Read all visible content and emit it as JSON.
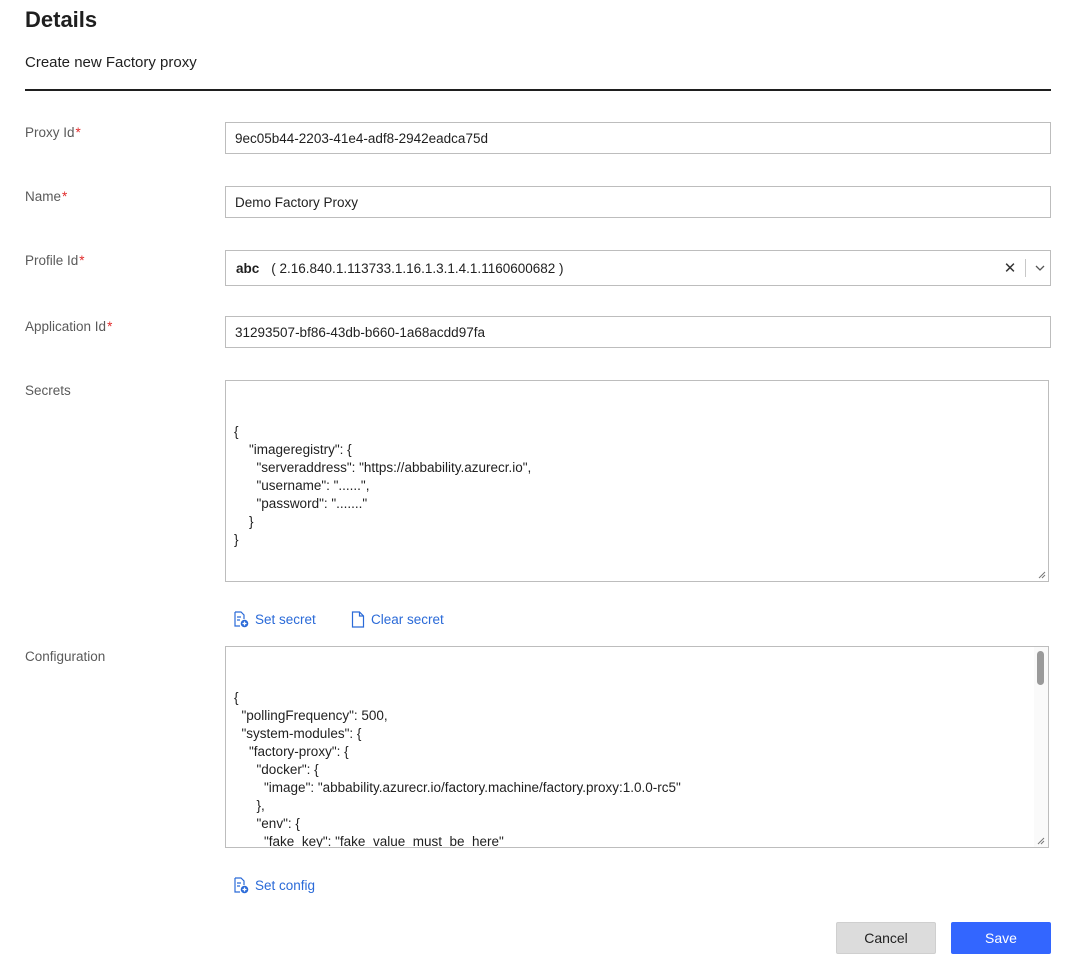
{
  "header": {
    "title": "Details",
    "subtitle": "Create new Factory proxy"
  },
  "fields": {
    "proxy_id": {
      "label": "Proxy Id",
      "required_mark": "*",
      "value": "9ec05b44-2203-41e4-adf8-2942eadca75d"
    },
    "name": {
      "label": "Name",
      "required_mark": "*",
      "value": "Demo Factory Proxy"
    },
    "profile_id": {
      "label": "Profile Id",
      "required_mark": "*",
      "selected_name": "abc",
      "selected_detail": "( 2.16.840.1.113733.1.16.1.3.1.4.1.1160600682 )"
    },
    "application_id": {
      "label": "Application Id",
      "required_mark": "*",
      "value": "31293507-bf86-43db-b660-1a68acdd97fa"
    },
    "secrets": {
      "label": "Secrets",
      "value": "{\n    \"imageregistry\": {\n      \"serveraddress\": \"https://abbability.azurecr.io\",\n      \"username\": \"......\",\n      \"password\": \".......\"\n    }\n}"
    },
    "configuration": {
      "label": "Configuration",
      "value": "{\n  \"pollingFrequency\": 500,\n  \"system-modules\": {\n    \"factory-proxy\": {\n      \"docker\": {\n        \"image\": \"abbability.azurecr.io/factory.machine/factory.proxy:1.0.0-rc5\"\n      },\n      \"env\": {\n        \"fake_key\": \"fake_value_must_be_here\"\n      }\n    },"
    }
  },
  "actions": {
    "set_secret": "Set secret",
    "clear_secret": "Clear secret",
    "set_config": "Set config"
  },
  "footer": {
    "cancel": "Cancel",
    "save": "Save"
  },
  "colors": {
    "accent": "#3366ff",
    "link": "#2a6ad8",
    "required": "#e12b2b"
  }
}
